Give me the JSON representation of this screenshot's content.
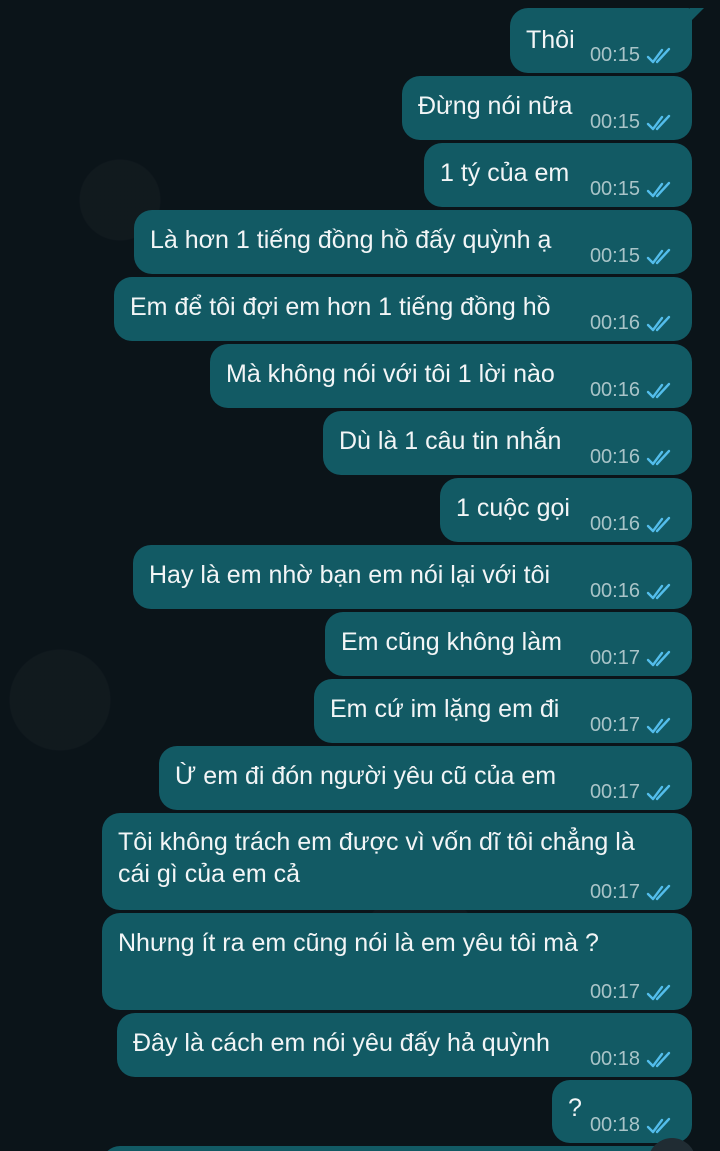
{
  "messages": [
    {
      "text": "Thôi",
      "time": "00:15"
    },
    {
      "text": "Đừng nói nữa",
      "time": "00:15"
    },
    {
      "text": "1 tý của em",
      "time": "00:15"
    },
    {
      "text": "Là hơn 1 tiếng đồng hồ đấy quỳnh ạ",
      "time": "00:15"
    },
    {
      "text": "Em để tôi đợi em hơn 1 tiếng đồng hồ",
      "time": "00:16"
    },
    {
      "text": "Mà không nói với tôi 1 lời nào",
      "time": "00:16"
    },
    {
      "text": "Dù là 1 câu tin nhắn",
      "time": "00:16"
    },
    {
      "text": "1 cuộc gọi",
      "time": "00:16"
    },
    {
      "text": "Hay là em nhờ bạn em nói lại với tôi",
      "time": "00:16"
    },
    {
      "text": "Em cũng không làm",
      "time": "00:17"
    },
    {
      "text": "Em cứ im lặng em đi",
      "time": "00:17"
    },
    {
      "text": "Ừ em đi đón người yêu cũ của em",
      "time": "00:17"
    },
    {
      "text": "Tôi không trách em được vì vốn dĩ tôi chẳng là cái gì của em cả",
      "time": "00:17"
    },
    {
      "text": "Nhưng ít ra em cũng nói là em yêu tôi mà ?",
      "time": "00:17"
    },
    {
      "text": "Đây là cách em nói yêu đấy hả quỳnh",
      "time": "00:18"
    },
    {
      "text": "?",
      "time": "00:18"
    }
  ],
  "status_icon": "double-check-read-icon",
  "colors": {
    "background": "#0b1419",
    "bubble": "#125a64",
    "text": "#f2f5f6",
    "meta": "#a9c4c8",
    "read_tick": "#53bdeb"
  }
}
